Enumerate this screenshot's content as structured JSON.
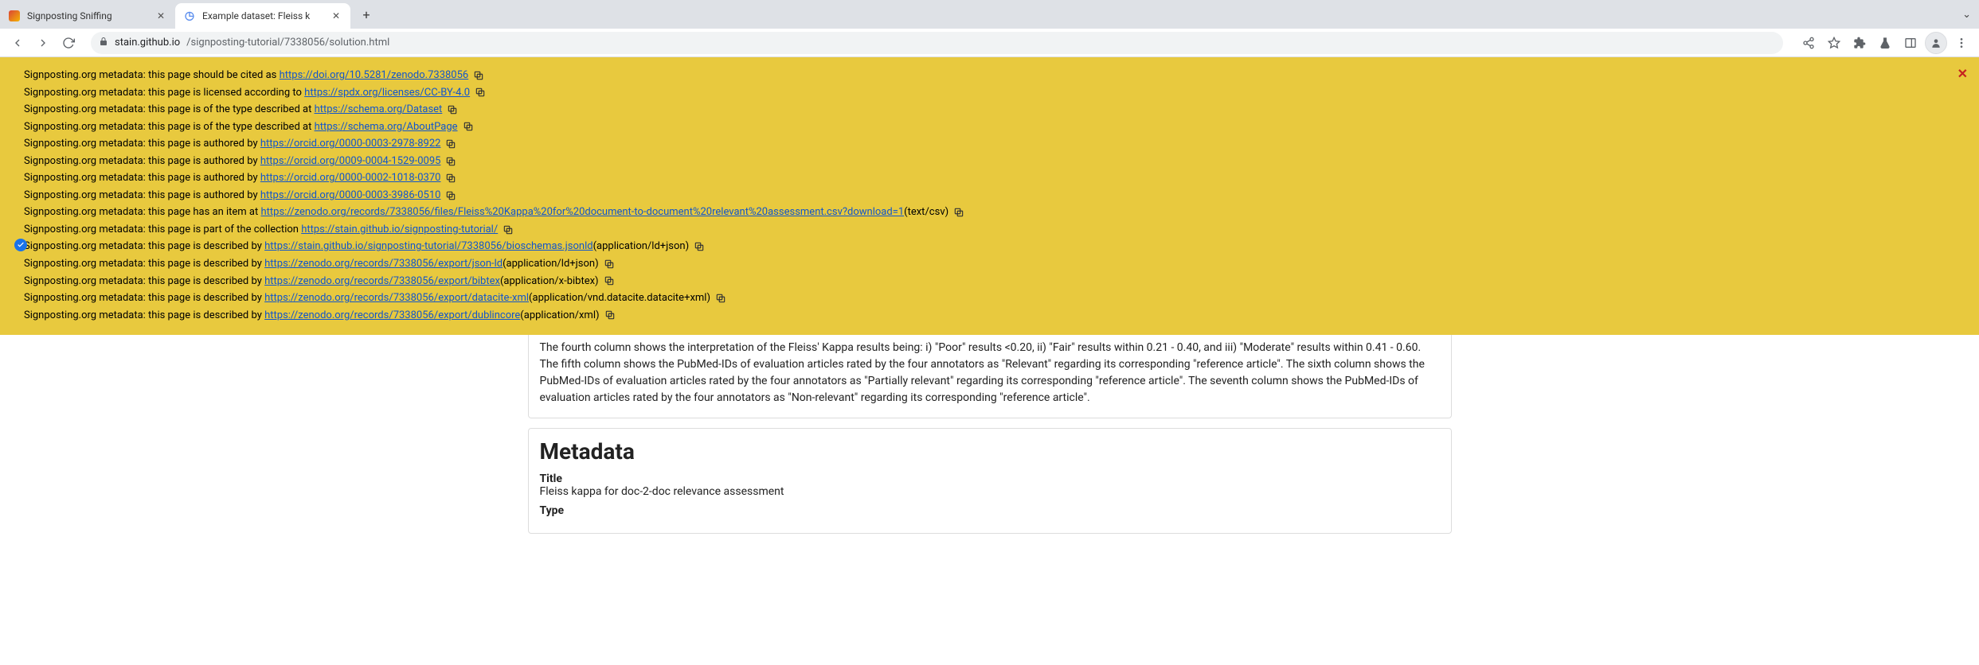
{
  "tabs": [
    {
      "title": "Signposting Sniffing",
      "active": false
    },
    {
      "title": "Example dataset: Fleiss k",
      "active": true
    }
  ],
  "url": {
    "domain": "stain.github.io",
    "path": "/signposting-tutorial/7338056/solution.html"
  },
  "notice": {
    "prefix_cited": "Signposting.org metadata: this page should be cited as ",
    "link_cited": "https://doi.org/10.5281/zenodo.7338056",
    "prefix_licensed": "Signposting.org metadata: this page is licensed according to ",
    "link_licensed": "https://spdx.org/licenses/CC-BY-4.0",
    "prefix_type": "Signposting.org metadata: this page is of the type described at ",
    "link_type1": "https://schema.org/Dataset",
    "link_type2": "https://schema.org/AboutPage",
    "prefix_authored": "Signposting.org metadata: this page is authored by ",
    "author1": "https://orcid.org/0000-0003-2978-8922",
    "author2": "https://orcid.org/0009-0004-1529-0095",
    "author3": "https://orcid.org/0000-0002-1018-0370",
    "author4": "https://orcid.org/0000-0003-3986-0510",
    "prefix_item": "Signposting.org metadata: this page has an item at ",
    "link_item": "https://zenodo.org/records/7338056/files/Fleiss%20Kappa%20for%20document-to-document%20relevant%20assessment.csv?download=1",
    "suffix_item": " (text/csv) ",
    "prefix_collection": "Signposting.org metadata: this page is part of the collection ",
    "link_collection": "https://stain.github.io/signposting-tutorial/",
    "prefix_described": "Signposting.org metadata: this page is described by ",
    "desc1_link": "https://stain.github.io/signposting-tutorial/7338056/bioschemas.jsonld",
    "desc1_suffix": " (application/ld+json) ",
    "desc2_link": "https://zenodo.org/records/7338056/export/json-ld",
    "desc2_suffix": " (application/ld+json) ",
    "desc3_link": "https://zenodo.org/records/7338056/export/bibtex",
    "desc3_suffix": " (application/x-bibtex) ",
    "desc4_link": "https://zenodo.org/records/7338056/export/datacite-xml",
    "desc4_suffix": " (application/vnd.datacite.datacite+xml) ",
    "desc5_link": "https://zenodo.org/records/7338056/export/dublincore",
    "desc5_suffix": " (application/xml) "
  },
  "content": {
    "description": "The fourth column shows the interpretation of the Fleiss' Kappa results being: i) \"Poor\" results <0.20, ii) \"Fair\" results within 0.21 - 0.40, and iii) \"Moderate\" results within 0.41 - 0.60. The fifth column shows the PubMed-IDs of evaluation articles rated by the four annotators as \"Relevant\" regarding its corresponding \"reference article\". The sixth column shows the PubMed-IDs of evaluation articles rated by the four annotators as \"Partially relevant\" regarding its corresponding \"reference article\". The seventh column shows the PubMed-IDs of evaluation articles rated by the four annotators as \"Non-relevant\" regarding its corresponding \"reference article\".",
    "metadata_heading": "Metadata",
    "title_label": "Title",
    "title_value": "Fleiss kappa for doc-2-doc relevance assessment",
    "type_label": "Type"
  }
}
